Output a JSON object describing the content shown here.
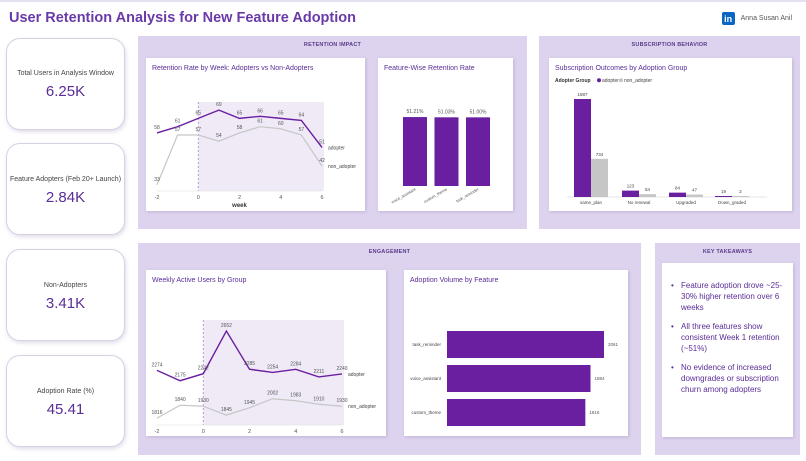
{
  "header": {
    "title": "User Retention Analysis for New Feature Adoption",
    "author": "Anna Susan Anil",
    "logo_text": "in"
  },
  "kpis": [
    {
      "label": "Total Users in Analysis Window",
      "value": "6.25K"
    },
    {
      "label": "Feature Adopters (Feb 20+ Launch)",
      "value": "2.84K"
    },
    {
      "label": "Non-Adopters",
      "value": "3.41K"
    },
    {
      "label": "Adoption Rate (%)",
      "value": "45.41"
    }
  ],
  "sections": {
    "retention": "RETENTION IMPACT",
    "subscription": "SUBSCRIPTION BEHAVIOR",
    "engagement": "ENGAGEMENT",
    "takeaways": "KEY TAKEAWAYS"
  },
  "takeaways": [
    "Feature adoption drove ~25-30% higher retention over 6 weeks",
    "All three features show consistent Week 1 retention (~51%)",
    "No evidence of increased downgrades or subscription churn among adopters"
  ],
  "colors": {
    "primary": "#6a1fa0",
    "secondary": "#c6c6c6",
    "section_bg": "#ddd3ee",
    "accent_text": "#5a2d97"
  },
  "chart_data": [
    {
      "id": "retention_by_week",
      "type": "line",
      "title": "Retention Rate by Week: Adopters vs Non-Adopters",
      "xlabel": "week",
      "x": [
        -2,
        -1,
        0,
        1,
        2,
        3,
        4,
        5,
        6
      ],
      "x_ticks": [
        -2,
        0,
        2,
        4,
        6
      ],
      "x_tick_labels": [
        "-2",
        "0",
        "2",
        "4",
        "6"
      ],
      "series": [
        {
          "name": "adopter",
          "values": [
            null,
            null,
            null,
            null,
            null,
            null,
            null,
            null,
            null
          ],
          "points": [
            [
              -2,
              58
            ],
            [
              -1,
              61
            ],
            [
              0,
              65
            ],
            [
              1,
              69
            ],
            [
              2,
              65
            ],
            [
              3,
              66
            ],
            [
              4,
              65
            ],
            [
              5,
              64
            ],
            [
              6,
              51
            ]
          ],
          "labels": [
            "58",
            "61",
            "65",
            "69",
            "65",
            "66",
            "65",
            "64",
            "51"
          ]
        },
        {
          "name": "non_adopter",
          "points": [
            [
              -2,
              33
            ],
            [
              -1,
              57
            ],
            [
              0,
              57
            ],
            [
              1,
              54
            ],
            [
              2,
              58
            ],
            [
              3,
              61
            ],
            [
              4,
              60
            ],
            [
              5,
              57
            ],
            [
              6,
              42
            ]
          ],
          "labels": [
            "33",
            "57",
            "57",
            "54",
            "58",
            "61",
            "60",
            "57",
            "42"
          ]
        }
      ],
      "highlight_from": 0
    },
    {
      "id": "feature_retention",
      "type": "bar",
      "title": "Feature-Wise Retention Rate",
      "categories": [
        "voice_assistant",
        "custom_theme",
        "task_reminder"
      ],
      "values": [
        51.21,
        51.03,
        51.0
      ],
      "labels": [
        "51.21%",
        "51.03%",
        "51.00%"
      ]
    },
    {
      "id": "subscription_outcomes",
      "type": "bar",
      "title": "Subscription Outcomes by Adoption Group",
      "legend_title": "Adopter Group",
      "series": [
        {
          "name": "adopter",
          "values": [
            1887,
            123,
            84,
            19
          ]
        },
        {
          "name": "non_adopter",
          "values": [
            734,
            54,
            47,
            2
          ]
        }
      ],
      "categories": [
        "same_plan",
        "No renewal",
        "Upgraded",
        "Down_graded"
      ]
    },
    {
      "id": "weekly_active_users",
      "type": "line",
      "title": "Weekly Active Users by Group",
      "xlabel": "week",
      "x_ticks": [
        -2,
        0,
        2,
        4,
        6
      ],
      "x_tick_labels": [
        "-2",
        "0",
        "2",
        "4",
        "6"
      ],
      "series": [
        {
          "name": "adopter",
          "points": [
            [
              -2,
              2274
            ],
            [
              -1,
              2175
            ],
            [
              0,
              2242
            ],
            [
              1,
              2652
            ],
            [
              2,
              2285
            ],
            [
              3,
              2254
            ],
            [
              4,
              2284
            ],
            [
              5,
              2211
            ],
            [
              6,
              2240
            ]
          ],
          "labels": [
            "2274",
            "2175",
            "2242",
            "2652",
            "2285",
            "2254",
            "2284",
            "2211",
            "2240"
          ]
        },
        {
          "name": "non_adopter",
          "points": [
            [
              -2,
              1816
            ],
            [
              -1,
              1940
            ],
            [
              0,
              1930
            ],
            [
              1,
              1845
            ],
            [
              2,
              1915
            ],
            [
              3,
              2002
            ],
            [
              4,
              1983
            ],
            [
              5,
              1949
            ],
            [
              6,
              1930
            ]
          ],
          "labels": [
            "1816",
            "1840",
            "1930",
            "1845",
            "1945",
            "2002",
            "1983",
            "1910",
            "1930"
          ]
        }
      ],
      "highlight_from": 0
    },
    {
      "id": "adoption_volume",
      "type": "bar",
      "title": "Adoption Volume by Feature",
      "categories": [
        "task_reminder",
        "voice_assistant",
        "custom_theme"
      ],
      "values": [
        2061,
        1884,
        1816
      ],
      "labels": [
        "2061",
        "1884",
        "1816"
      ]
    }
  ]
}
